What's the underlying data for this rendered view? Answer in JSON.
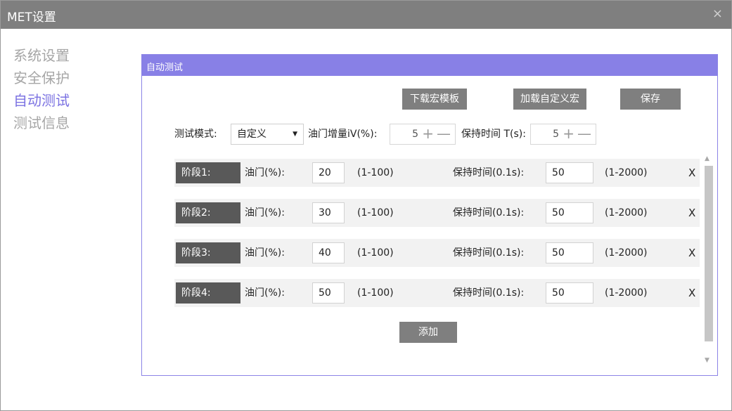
{
  "window": {
    "title": "MET设置",
    "close_glyph": "×"
  },
  "sidebar": {
    "items": [
      {
        "label": "系统设置",
        "active": false
      },
      {
        "label": "安全保护",
        "active": false
      },
      {
        "label": "自动测试",
        "active": true
      },
      {
        "label": "测试信息",
        "active": false
      }
    ]
  },
  "panel": {
    "title": "自动测试",
    "buttons": {
      "download_template": "下载宏模板",
      "load_custom_macro": "加载自定义宏",
      "save": "保存",
      "add": "添加"
    },
    "settings": {
      "mode_label": "测试模式:",
      "mode_value": "自定义",
      "throttle_increment_label": "油门增量iV(%):",
      "throttle_increment_value": "5",
      "hold_time_label": "保持时间 T(s):",
      "hold_time_value": "5",
      "plus_glyph": "+",
      "minus_glyph": "—",
      "caret_glyph": "▼"
    },
    "stages": [
      {
        "name": "阶段1:",
        "throttle_label": "油门(%):",
        "throttle": "20",
        "throttle_range": "(1-100)",
        "hold_label": "保持时间(0.1s):",
        "hold": "50",
        "hold_range": "(1-2000)",
        "delete": "X"
      },
      {
        "name": "阶段2:",
        "throttle_label": "油门(%):",
        "throttle": "30",
        "throttle_range": "(1-100)",
        "hold_label": "保持时间(0.1s):",
        "hold": "50",
        "hold_range": "(1-2000)",
        "delete": "X"
      },
      {
        "name": "阶段3:",
        "throttle_label": "油门(%):",
        "throttle": "40",
        "throttle_range": "(1-100)",
        "hold_label": "保持时间(0.1s):",
        "hold": "50",
        "hold_range": "(1-2000)",
        "delete": "X"
      },
      {
        "name": "阶段4:",
        "throttle_label": "油门(%):",
        "throttle": "50",
        "throttle_range": "(1-100)",
        "hold_label": "保持时间(0.1s):",
        "hold": "50",
        "hold_range": "(1-2000)",
        "delete": "X"
      }
    ],
    "scrollbar": {
      "up_glyph": "▲",
      "down_glyph": "▼"
    }
  },
  "colors": {
    "titlebar": "#7f7f7f",
    "accent": "#8880e6",
    "active_nav": "#7b72e2",
    "button": "#7f7f7f",
    "stage_badge": "#595959"
  }
}
